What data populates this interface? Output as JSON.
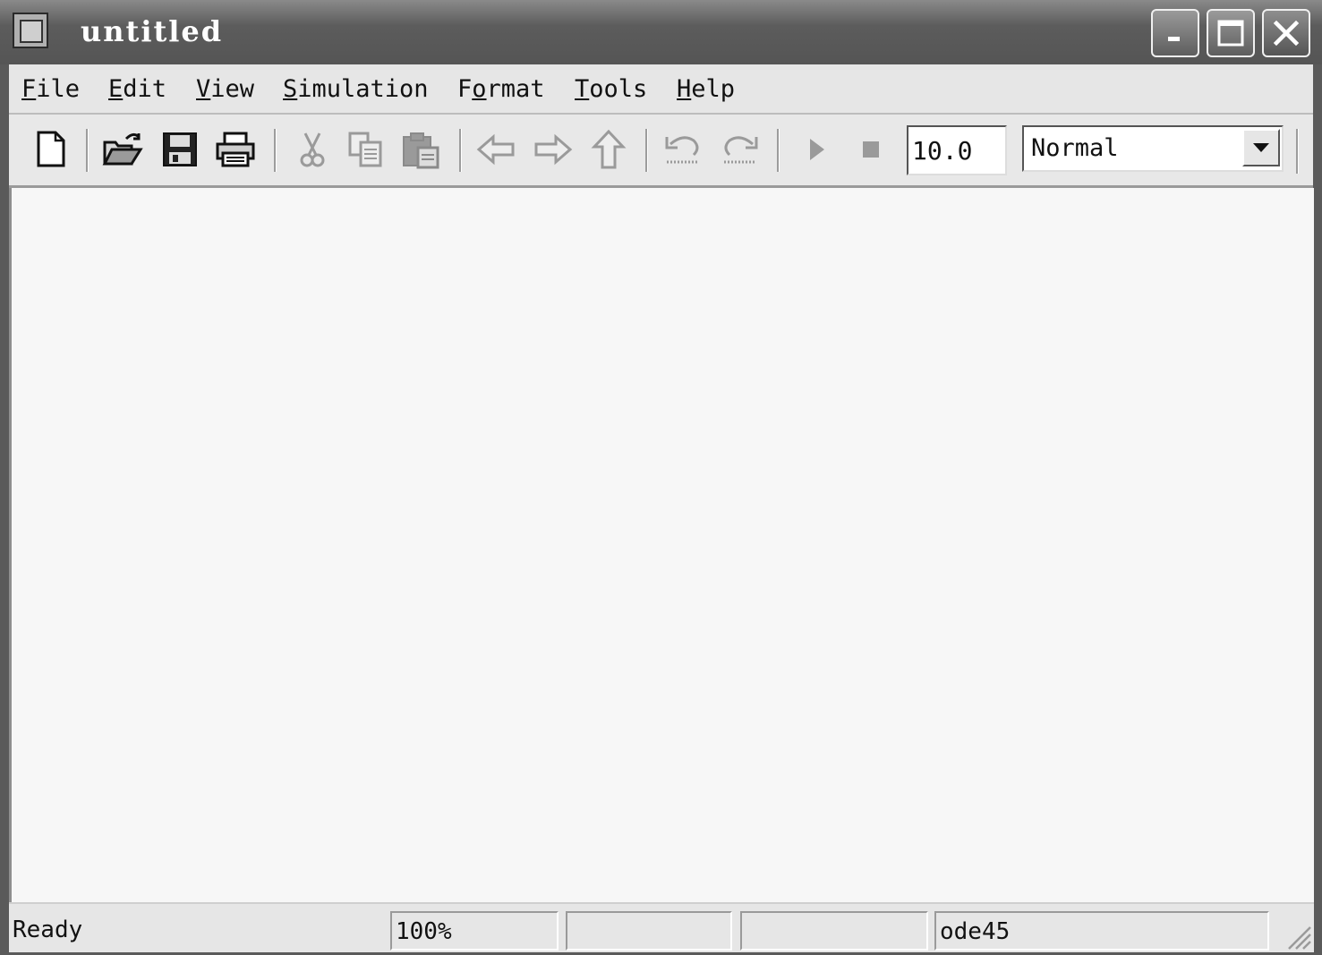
{
  "window": {
    "title": "untitled"
  },
  "menu": {
    "items": [
      {
        "first": "F",
        "rest": "ile"
      },
      {
        "first": "E",
        "rest": "dit"
      },
      {
        "first": "V",
        "rest": "iew"
      },
      {
        "first": "S",
        "rest": "imulation"
      },
      {
        "first": "F",
        "rest": "ormat",
        "prefix": "F",
        "ul": "o",
        "after": "rmat"
      },
      {
        "first": "T",
        "rest": "ools"
      },
      {
        "first": "H",
        "rest": "elp"
      }
    ]
  },
  "toolbar": {
    "icons": [
      "new-model-icon",
      "open-folder-icon",
      "save-disk-icon",
      "printer-icon",
      "cut-icon",
      "copy-icon",
      "paste-icon",
      "back-arrow-icon",
      "forward-arrow-icon",
      "up-arrow-icon",
      "undo-icon",
      "redo-icon",
      "play-icon",
      "stop-icon"
    ],
    "stop_time": "10.0",
    "sim_mode": "Normal"
  },
  "status": {
    "state": "Ready",
    "zoom": "100%",
    "cell3": "",
    "cell4": "",
    "solver": "ode45"
  }
}
